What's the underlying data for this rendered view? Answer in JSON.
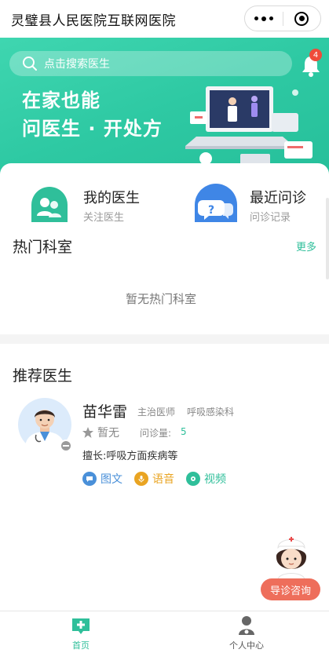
{
  "header": {
    "title": "灵璧县人民医院互联网医院"
  },
  "banner": {
    "search_placeholder": "点击搜索医生",
    "notification_count": "4",
    "slogan_line1": "在家也能",
    "slogan_line2": "问医生 · 开处方",
    "accent_color": "#2ec9a3"
  },
  "quick_links": [
    {
      "title": "我的医生",
      "subtitle": "关注医生",
      "icon": "doctor-users-icon"
    },
    {
      "title": "最近问诊",
      "subtitle": "问诊记录",
      "icon": "chat-question-icon"
    }
  ],
  "hot_departments": {
    "title": "热门科室",
    "more": "更多",
    "empty_text": "暂无热门科室"
  },
  "recommended": {
    "title": "推荐医生",
    "doctors": [
      {
        "name": "苗华雷",
        "title": "主治医师",
        "department": "呼吸感染科",
        "rating": "暂无",
        "volume_label": "问诊量:",
        "volume": "5",
        "specialty": "擅长:呼吸方面疾病等",
        "services": [
          {
            "label": "图文",
            "color": "#4a90d9",
            "icon": "chat-bubble-icon"
          },
          {
            "label": "语音",
            "color": "#e9a422",
            "icon": "microphone-icon"
          },
          {
            "label": "视频",
            "color": "#2fbf9a",
            "icon": "video-icon"
          }
        ]
      }
    ]
  },
  "guide": {
    "label": "导诊咨询"
  },
  "tabbar": [
    {
      "label": "首页",
      "active": true,
      "color": "#2fbf9a"
    },
    {
      "label": "个人中心",
      "active": false,
      "color": "#555555"
    }
  ]
}
